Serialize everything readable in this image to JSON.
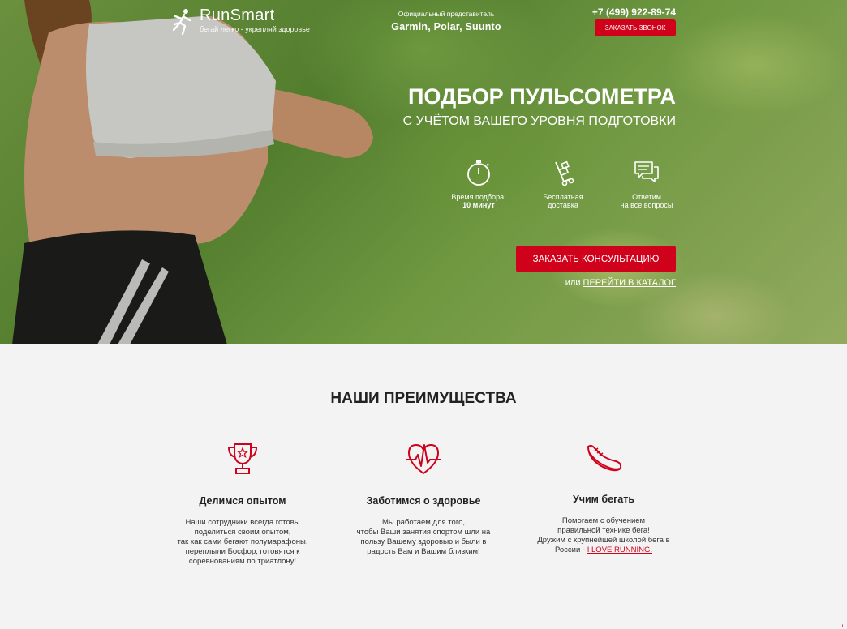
{
  "brand": {
    "name": "RunSmart",
    "tagline": "бегай легко - укрепляй здоровье"
  },
  "header": {
    "rep_label": "Официальный представитель",
    "rep_brands": "Garmin, Polar, Suunto",
    "phone": "+7 (499) 922-89-74",
    "call_button": "ЗАКАЗАТЬ ЗВОНОК"
  },
  "hero": {
    "title": "ПОДБОР ПУЛЬСОМЕТРА",
    "subtitle": "С УЧЁТОМ ВАШЕГО УРОВНЯ ПОДГОТОВКИ",
    "features": [
      {
        "icon": "stopwatch-icon",
        "line1": "Время подбора:",
        "line2": "10 минут"
      },
      {
        "icon": "delivery-cart-icon",
        "line1": "Бесплатная",
        "line2": "доставка"
      },
      {
        "icon": "chat-icon",
        "line1": "Ответим",
        "line2": "на все вопросы"
      }
    ],
    "consult_button": "ЗАКАЗАТЬ КОНСУЛЬТАЦИЮ",
    "or_text": "или",
    "catalog_link": "ПЕРЕЙТИ В КАТАЛОГ"
  },
  "advantages": {
    "title": "НАШИ ПРЕИМУЩЕСТВА",
    "items": [
      {
        "icon": "trophy-icon",
        "heading": "Делимся опытом",
        "lines": [
          "Наши сотрудники всегда готовы",
          "поделиться своим опытом,",
          "так как сами бегают полумарафоны,",
          "переплыли Босфор, готовятся к",
          "соревнованиям по триатлону!"
        ]
      },
      {
        "icon": "heart-pulse-icon",
        "heading": "Заботимся о здоровье",
        "lines": [
          "Мы работаем для того,",
          "чтобы Ваши занятия спортом шли на",
          "пользу Вашему здоровью и были в",
          "радость Вам и Вашим близким!"
        ]
      },
      {
        "icon": "running-shoe-icon",
        "heading": "Учим бегать",
        "lines": [
          "Помогаем с обучением",
          "правильной технике бега!",
          "Дружим с крупнейшей школой бега в"
        ],
        "last_prefix": "России - ",
        "link": "I LOVE RUNNING."
      }
    ]
  },
  "colors": {
    "accent": "#d0021b",
    "background": "#f3f3f3"
  }
}
